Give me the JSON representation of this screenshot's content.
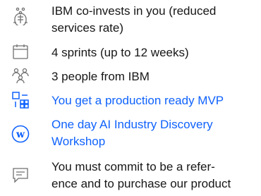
{
  "benefits": {
    "items": [
      {
        "icon": "co-invest-icon",
        "lines": [
          "IBM co-invests in you (reduced",
          "services rate)"
        ],
        "is_link": false
      },
      {
        "icon": "calendar-icon",
        "lines": [
          "4 sprints (up to 12 weeks)"
        ],
        "is_link": false
      },
      {
        "icon": "people-group-icon",
        "lines": [
          "3 people from IBM"
        ],
        "is_link": false
      },
      {
        "icon": "mvp-blocks-icon",
        "lines": [
          "You get a production ready MVP"
        ],
        "is_link": true
      },
      {
        "icon": "workshop-w-icon",
        "lines": [
          "One day AI Industry Discovery",
          "Workshop"
        ],
        "is_link": true
      },
      {
        "icon": "chat-bubble-icon",
        "lines": [
          "You must commit to be a refer-",
          "ence and to purchase our product"
        ],
        "is_link": false
      }
    ]
  },
  "colors": {
    "text": "#161616",
    "link": "#0f62fe",
    "icon_gray": "#6f6f6f",
    "icon_blue": "#0f62fe"
  }
}
